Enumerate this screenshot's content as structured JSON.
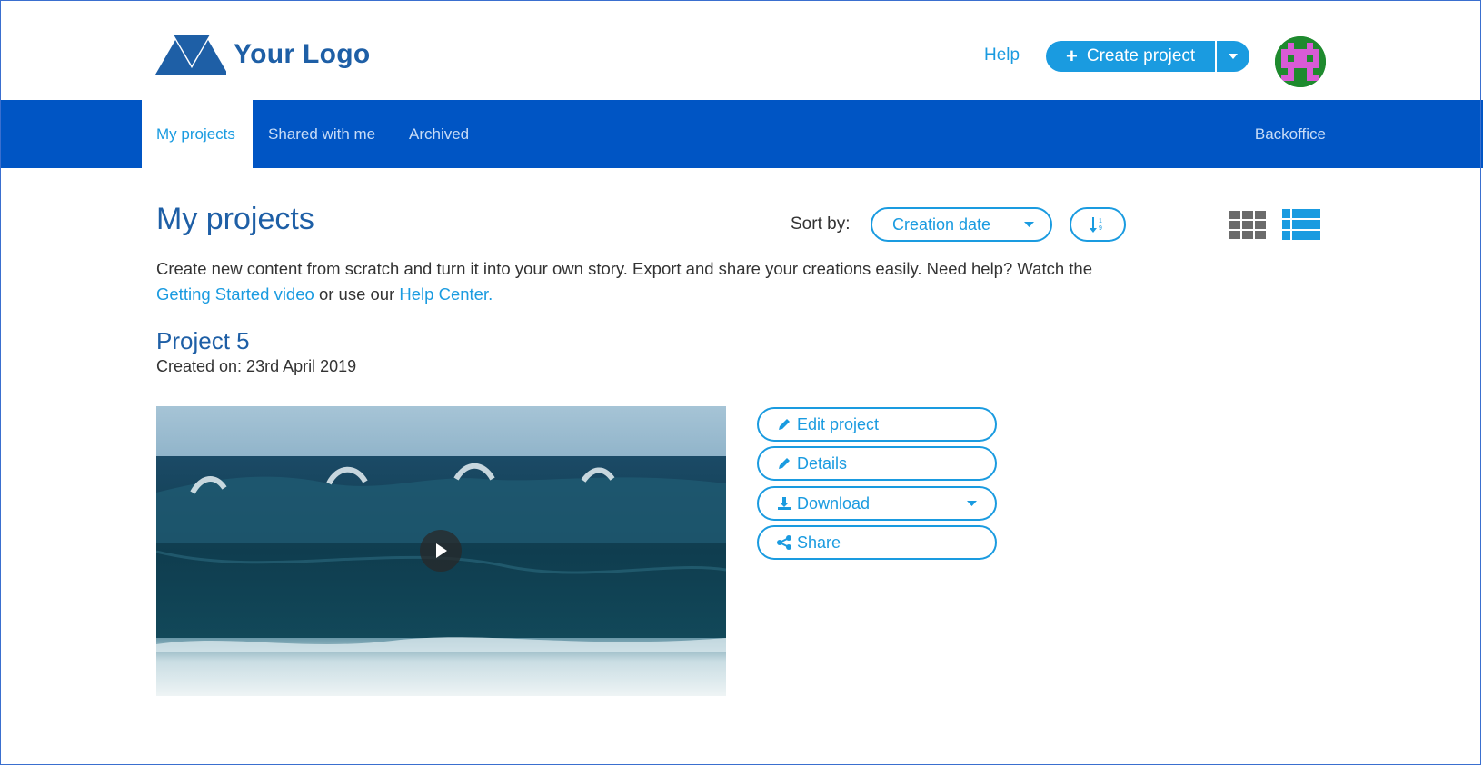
{
  "brand": {
    "logo_text": "Your Logo"
  },
  "header": {
    "help_label": "Help",
    "create_label": "Create project"
  },
  "nav": {
    "items": [
      {
        "label": "My projects",
        "active": true
      },
      {
        "label": "Shared with me",
        "active": false
      },
      {
        "label": "Archived",
        "active": false
      }
    ],
    "backoffice_label": "Backoffice"
  },
  "page": {
    "title": "My projects",
    "sort_label": "Sort by:",
    "sort_value": "Creation date",
    "intro_text": "Create new content from scratch and turn it into your own story. Export and share your creations easily. Need help? Watch the",
    "intro_link1": "Getting Started video",
    "intro_mid": "or use our",
    "intro_link2": "Help Center."
  },
  "project": {
    "title": "Project 5",
    "created": "Created on: 23rd April 2019",
    "actions": {
      "edit": "Edit project",
      "details": "Details",
      "download": "Download",
      "share": "Share"
    }
  },
  "colors": {
    "accent": "#1a9be0",
    "nav_bg": "#0055c4",
    "title": "#1e5fa6"
  },
  "icons": [
    "logo-triangles-icon",
    "plus-icon",
    "chevron-down-icon",
    "sort-order-icon",
    "grid-view-icon",
    "list-view-icon",
    "play-icon",
    "pencil-icon",
    "download-icon",
    "share-icon"
  ]
}
